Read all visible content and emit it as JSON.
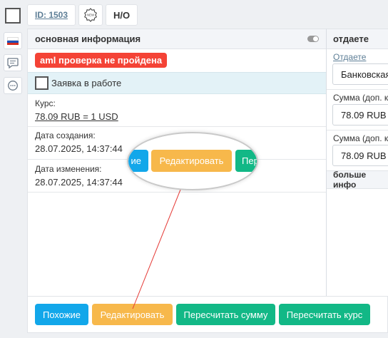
{
  "topbar": {
    "id_label": "ID: 1503",
    "status_label": "Н/О"
  },
  "main_panel": {
    "title": "основная информация",
    "aml_badge": "aml проверка не пройдена",
    "in_work_label": "Заявка в работе",
    "rate_label": "Курс:",
    "rate_value": "78.09 RUB = 1 USD",
    "created_label": "Дата создания:",
    "created_value": "28.07.2025, 14:37:44",
    "changed_label": "Дата изменения:",
    "changed_value": "28.07.2025, 14:37:44"
  },
  "zoom": {
    "left_partial": "ие",
    "edit_label": "Редактировать",
    "right_partial": "Пер"
  },
  "right_panel": {
    "title": "отдаете",
    "gives_label": "Отдаете",
    "bank_value": "Банковская",
    "sum1_label": "Сумма (доп. к",
    "sum1_value": "78.09 RUB",
    "sum2_label": "Сумма (доп. к",
    "sum2_value": "78.09 RUB",
    "more_info": "больше инфо"
  },
  "footer": {
    "similar": "Похожие",
    "edit": "Редактировать",
    "recalc_sum": "Пересчитать сумму",
    "recalc_rate": "Пересчитать курс"
  },
  "colors": {
    "blue": "#12a7ea",
    "orange": "#f7b84b",
    "green": "#12b886",
    "red": "#f44336"
  }
}
